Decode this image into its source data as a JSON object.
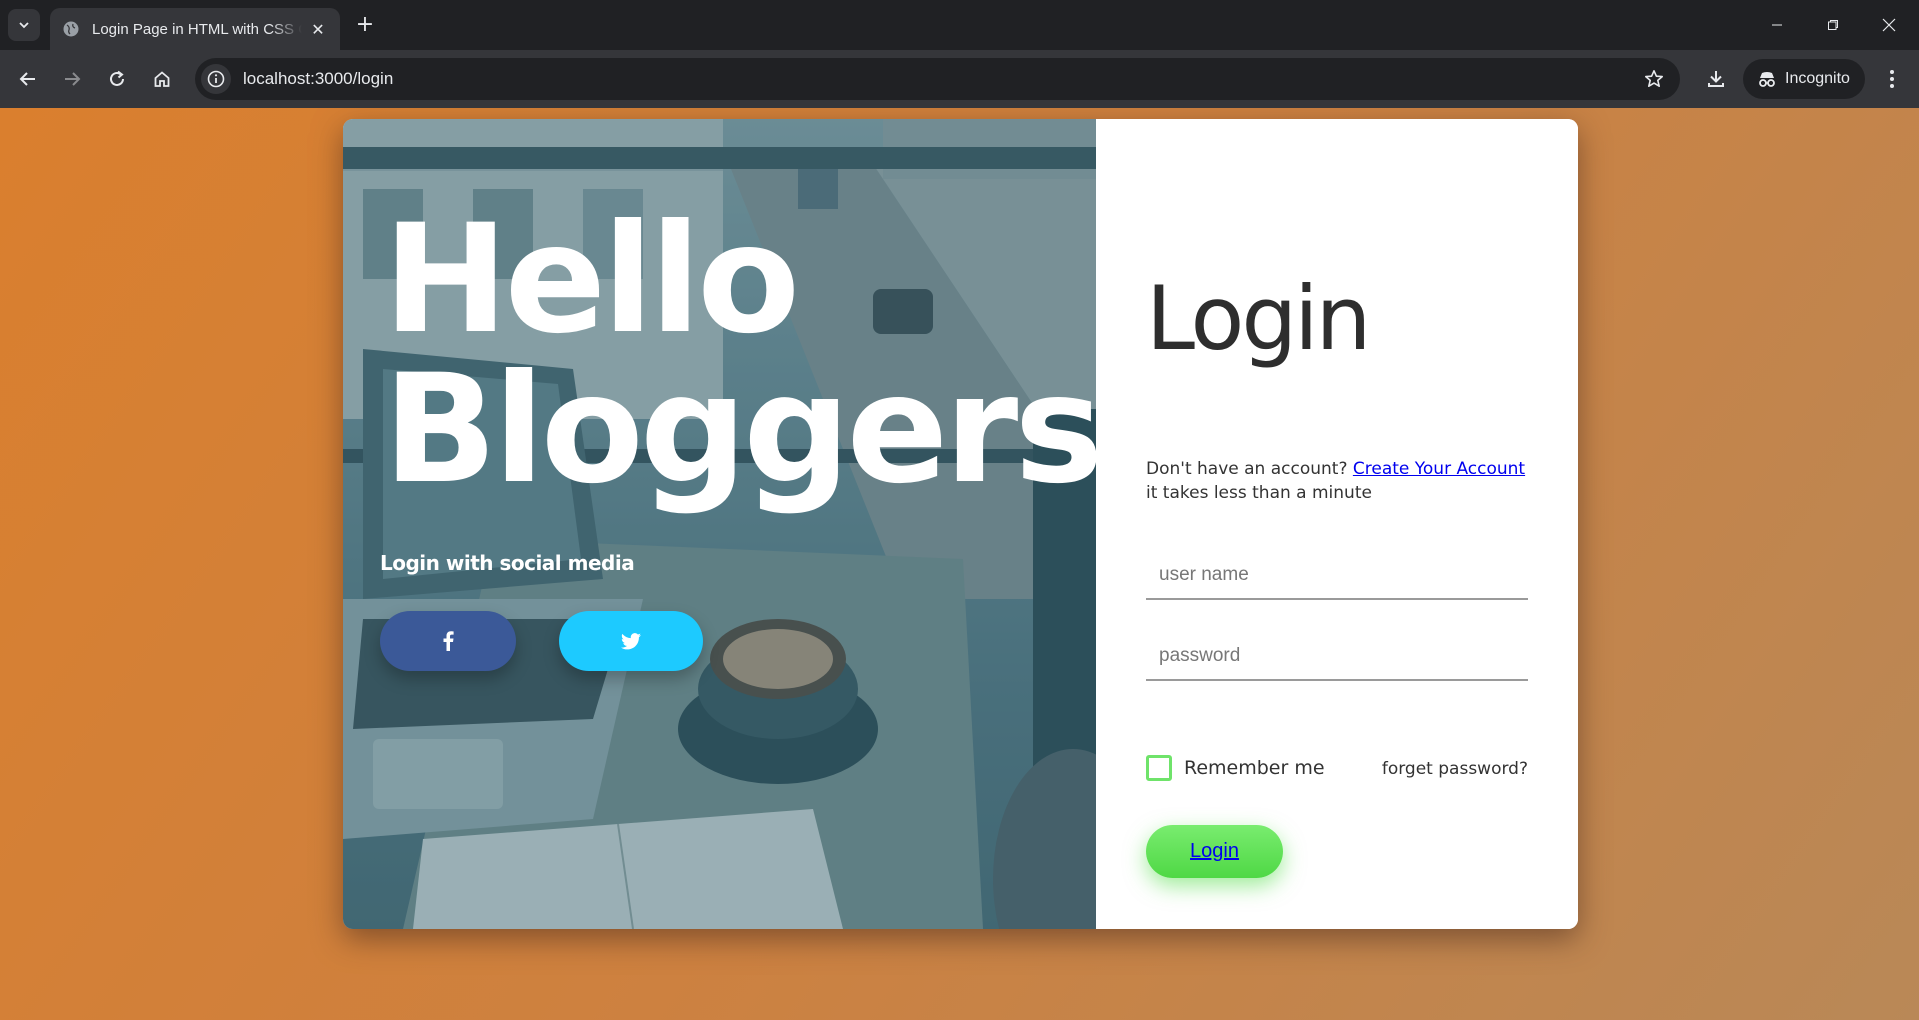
{
  "browser": {
    "tab_title": "Login Page in HTML with CSS Code",
    "tab_close": "✕",
    "new_tab": "+",
    "url": "localhost:3000/login",
    "incognito_label": "Incognito"
  },
  "hero": {
    "line1": "Hello",
    "line2": "Bloggers!",
    "social_label": "Login with social media"
  },
  "form": {
    "title": "Login",
    "signup_prefix": "Don't have an account? ",
    "signup_link": "Create Your Account",
    "signup_suffix": " it takes less than a minute",
    "username_placeholder": "user name",
    "password_placeholder": "password",
    "remember_label": "Remember me",
    "forget_label": "forget password?",
    "login_button": "Login"
  },
  "colors": {
    "background_start": "#da7f2e",
    "background_end": "#b98857",
    "facebook": "#3b5998",
    "twitter": "#1dcaff",
    "login_button": "#5ee053",
    "checkbox_border": "#6fe36a"
  },
  "icons": {
    "facebook": "facebook-icon",
    "twitter": "twitter-icon"
  }
}
